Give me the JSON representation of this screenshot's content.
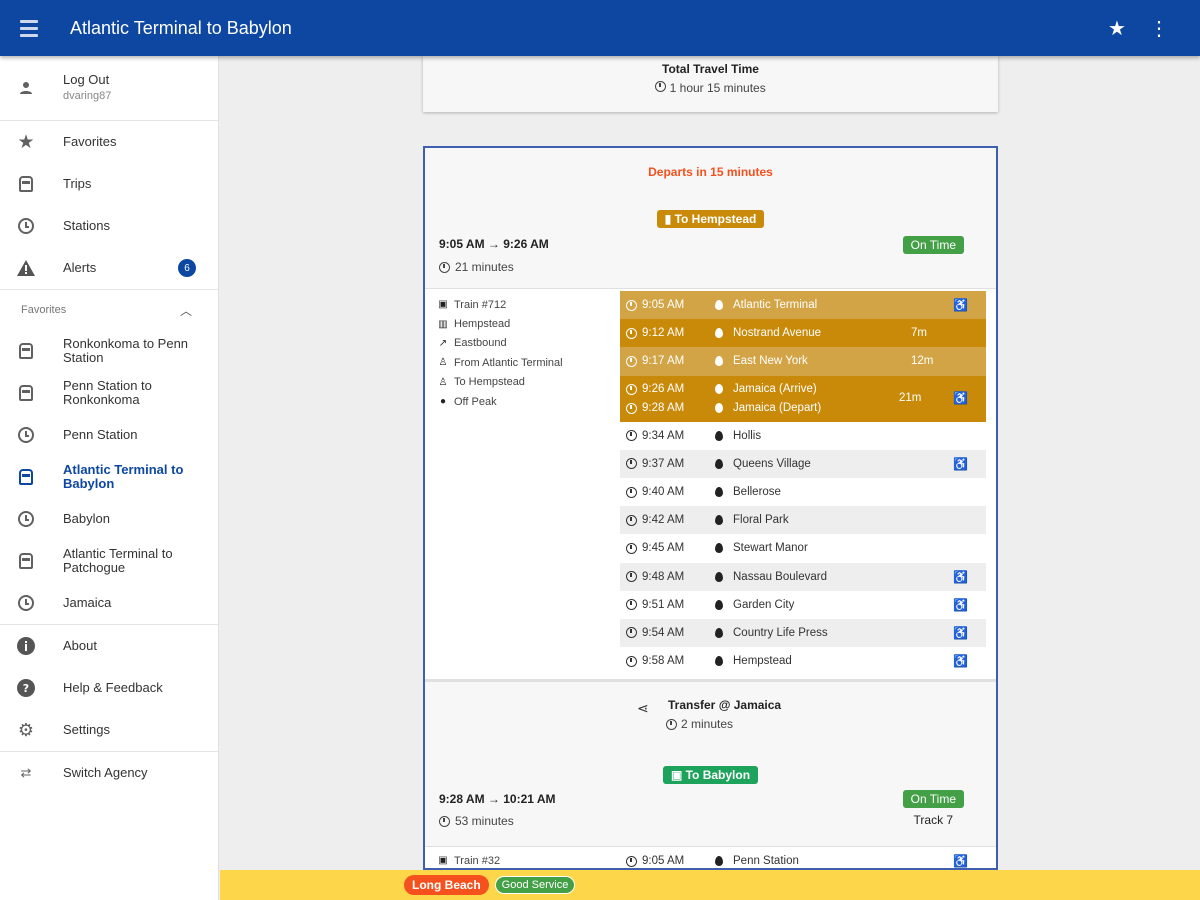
{
  "appbar": {
    "title": "Atlantic Terminal to Babylon",
    "star_icon": "★",
    "more_icon": "⋮"
  },
  "drawer": {
    "account": {
      "label": "Log Out",
      "username": "dvaring87"
    },
    "nav": [
      {
        "label": "Favorites",
        "icon": "star-icon"
      },
      {
        "label": "Trips",
        "icon": "train-icon"
      },
      {
        "label": "Stations",
        "icon": "clock-icon"
      },
      {
        "label": "Alerts",
        "icon": "warning-icon",
        "badge": "6"
      }
    ],
    "favorites_header": "Favorites",
    "favorites": [
      {
        "label": "Ronkonkoma to Penn Station",
        "icon": "train-icon"
      },
      {
        "label": "Penn Station to Ronkonkoma",
        "icon": "train-icon"
      },
      {
        "label": "Penn Station",
        "icon": "clock-icon"
      },
      {
        "label": "Atlantic Terminal to Babylon",
        "icon": "train-icon",
        "active": true
      },
      {
        "label": "Babylon",
        "icon": "clock-icon"
      },
      {
        "label": "Atlantic Terminal to Patchogue",
        "icon": "train-icon"
      },
      {
        "label": "Jamaica",
        "icon": "clock-icon"
      }
    ],
    "bottom": [
      {
        "label": "About",
        "icon": "info-icon"
      },
      {
        "label": "Help & Feedback",
        "icon": "help-icon"
      },
      {
        "label": "Settings",
        "icon": "gear-icon"
      }
    ],
    "switch_agency": "Switch Agency"
  },
  "summary": {
    "title": "Total Travel Time",
    "value": "1 hour 15 minutes"
  },
  "trip": {
    "departs": "Departs in 15 minutes",
    "leg1": {
      "destination_pill": "To Hempstead",
      "times": "9:05 AM → 9:26 AM",
      "duration": "21 minutes",
      "status": "On Time",
      "info": [
        {
          "icon": "train-icon",
          "text": "Train #712"
        },
        {
          "icon": "map-icon",
          "text": "Hempstead"
        },
        {
          "icon": "direction-icon",
          "text": "Eastbound"
        },
        {
          "icon": "person-pin-icon",
          "text": "From Atlantic Terminal"
        },
        {
          "icon": "person-pin-icon",
          "text": "To Hempstead"
        },
        {
          "icon": "peak-icon",
          "text": "Off Peak"
        }
      ],
      "stops": [
        {
          "time": "9:05 AM",
          "name": "Atlantic Terminal",
          "delay": "",
          "accessible": true,
          "style": "hl2"
        },
        {
          "time": "9:12 AM",
          "name": "Nostrand Avenue",
          "delay": "7m",
          "accessible": false,
          "style": "hl"
        },
        {
          "time": "9:17 AM",
          "name": "East New York",
          "delay": "12m",
          "accessible": false,
          "style": "hl2"
        }
      ],
      "double_stop": {
        "arrive_time": "9:26 AM",
        "arrive_name": "Jamaica (Arrive)",
        "depart_time": "9:28 AM",
        "depart_name": "Jamaica (Depart)",
        "delay": "21m"
      },
      "after_stops": [
        {
          "time": "9:34 AM",
          "name": "Hollis",
          "accessible": false,
          "style": ""
        },
        {
          "time": "9:37 AM",
          "name": "Queens Village",
          "accessible": true,
          "style": "grey"
        },
        {
          "time": "9:40 AM",
          "name": "Bellerose",
          "accessible": false,
          "style": ""
        },
        {
          "time": "9:42 AM",
          "name": "Floral Park",
          "accessible": false,
          "style": "grey"
        },
        {
          "time": "9:45 AM",
          "name": "Stewart Manor",
          "accessible": false,
          "style": ""
        },
        {
          "time": "9:48 AM",
          "name": "Nassau Boulevard",
          "accessible": true,
          "style": "grey"
        },
        {
          "time": "9:51 AM",
          "name": "Garden City",
          "accessible": true,
          "style": ""
        },
        {
          "time": "9:54 AM",
          "name": "Country Life Press",
          "accessible": true,
          "style": "grey"
        },
        {
          "time": "9:58 AM",
          "name": "Hempstead",
          "accessible": true,
          "style": ""
        }
      ]
    },
    "transfer": {
      "title": "Transfer @ Jamaica",
      "duration": "2 minutes"
    },
    "leg2": {
      "destination_pill": "To Babylon",
      "times": "9:28 AM → 10:21 AM",
      "duration": "53 minutes",
      "status": "On Time",
      "track": "Track 7",
      "info_first": "Train #32",
      "first_stop": {
        "time": "9:05 AM",
        "name": "Penn Station",
        "accessible": true
      }
    }
  },
  "statusbar": {
    "branch": "Long Beach",
    "service": "Good Service"
  },
  "colors": {
    "appbar": "#0d47a1",
    "highlight": "#c98a0a",
    "on_time": "#43a047",
    "departs": "#f4511e",
    "status_bar": "#fdd64a"
  }
}
